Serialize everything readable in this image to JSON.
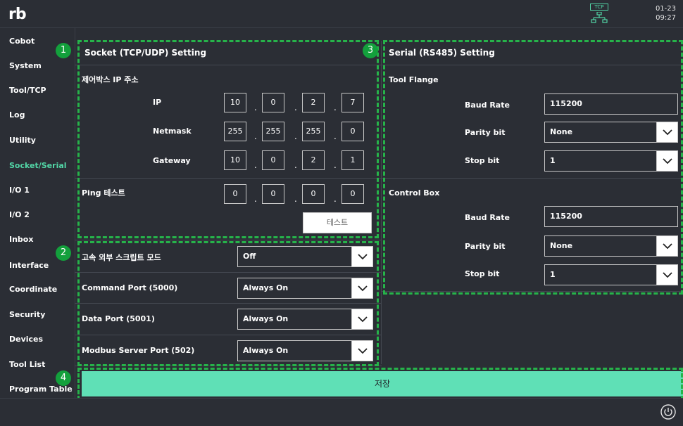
{
  "header": {
    "logo": "rb",
    "tcp_badge": "TCP",
    "date": "01-23",
    "time": "09:27"
  },
  "sidebar": {
    "items": [
      {
        "label": "Cobot"
      },
      {
        "label": "System"
      },
      {
        "label": "Tool/TCP"
      },
      {
        "label": "Log"
      },
      {
        "label": "Utility"
      },
      {
        "label": "Socket/Serial",
        "active": true
      },
      {
        "label": "I/O 1"
      },
      {
        "label": "I/O 2"
      },
      {
        "label": "Inbox"
      },
      {
        "label": "Interface"
      },
      {
        "label": "Coordinate"
      },
      {
        "label": "Security"
      },
      {
        "label": "Devices"
      },
      {
        "label": "Tool List"
      },
      {
        "label": "Program Table"
      }
    ]
  },
  "socket": {
    "title": "Socket (TCP/UDP) Setting",
    "section_ip": "제어박스 IP 주소",
    "ip_label": "IP",
    "ip": [
      "10",
      "0",
      "2",
      "7"
    ],
    "netmask_label": "Netmask",
    "netmask": [
      "255",
      "255",
      "255",
      "0"
    ],
    "gateway_label": "Gateway",
    "gateway": [
      "10",
      "0",
      "2",
      "1"
    ],
    "ping_label": "Ping 테스트",
    "ping": [
      "0",
      "0",
      "0",
      "0"
    ],
    "test_button": "테스트"
  },
  "ports": [
    {
      "label": "고속 외부 스크립트 모드",
      "value": "Off"
    },
    {
      "label": "Command Port (5000)",
      "value": "Always On"
    },
    {
      "label": "Data Port (5001)",
      "value": "Always On"
    },
    {
      "label": "Modbus Server Port (502)",
      "value": "Always On"
    }
  ],
  "serial": {
    "title": "Serial (RS485) Setting",
    "tool_flange": {
      "label": "Tool Flange",
      "baud_label": "Baud Rate",
      "baud": "115200",
      "parity_label": "Parity bit",
      "parity": "None",
      "stop_label": "Stop bit",
      "stop": "1"
    },
    "control_box": {
      "label": "Control Box",
      "baud_label": "Baud Rate",
      "baud": "115200",
      "parity_label": "Parity bit",
      "parity": "None",
      "stop_label": "Stop bit",
      "stop": "1"
    }
  },
  "save_button": "저장",
  "badges": [
    "1",
    "2",
    "3",
    "4"
  ],
  "colors": {
    "accent": "#52d5a6",
    "save": "#5fe0b6",
    "annotation": "#26b34a",
    "badge": "#13a03c",
    "background": "#2b2e35"
  }
}
